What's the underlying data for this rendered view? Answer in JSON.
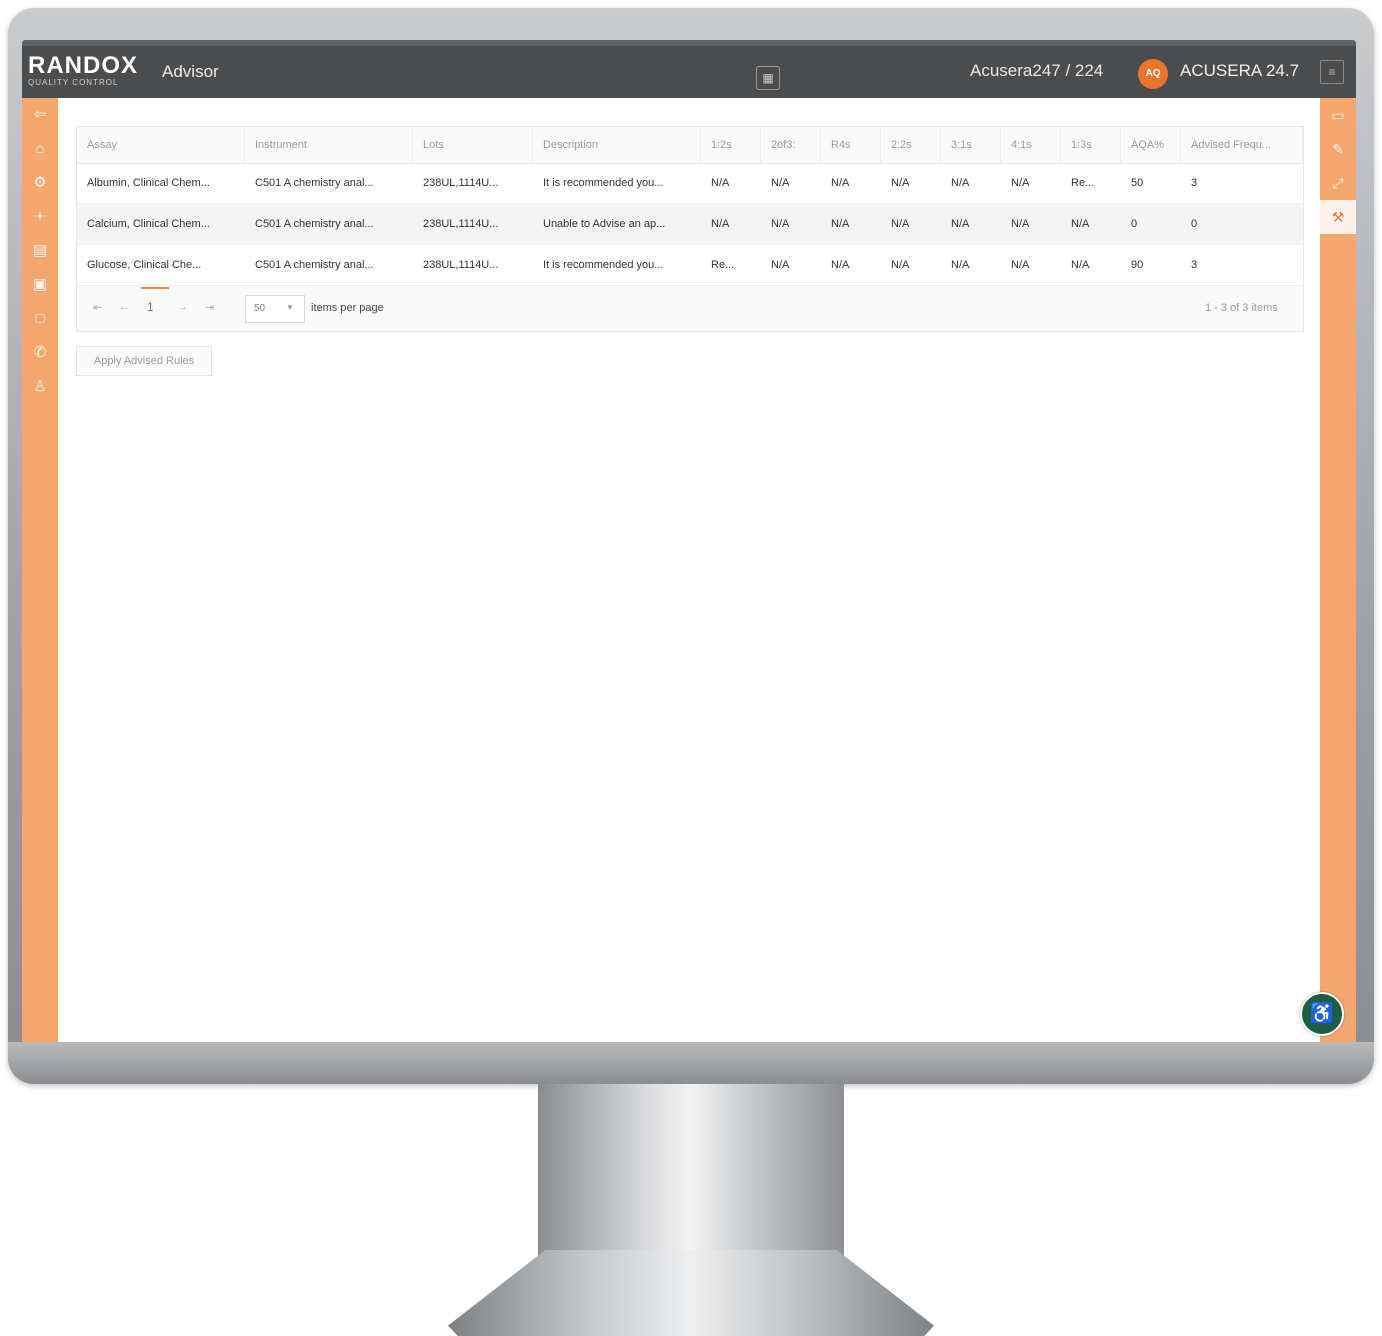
{
  "topbar": {
    "logo_main": "RANDOX",
    "logo_sub": "QUALITY CONTROL",
    "app_title": "Advisor",
    "center_icon": "grid-icon",
    "lab_name": "Acusera247 / 224",
    "user_initials": "AQ",
    "version": "ACUSERA 24.7",
    "menu_icon": "menu-icon"
  },
  "left_nav_icons": [
    "back-icon",
    "home-icon",
    "settings-icon",
    "plus-icon",
    "dashboard-icon",
    "report-icon",
    "document-icon",
    "phone-icon",
    "user-icon"
  ],
  "right_nav_icons": [
    "panel-icon",
    "edit-icon",
    "chart-icon",
    "wrench-icon"
  ],
  "grid": {
    "columns": [
      "Assay",
      "Instrument",
      "Lots",
      "Description",
      "1:2s",
      "2of3:",
      "R4s",
      "2:2s",
      "3:1s",
      "4:1s",
      "1:3s",
      "AQA%",
      "Advised Frequ..."
    ],
    "rows": [
      [
        "Albumin, Clinical Chem...",
        "C501 A chemistry anal...",
        "238UL,1114U...",
        "It is recommended you...",
        "N/A",
        "N/A",
        "N/A",
        "N/A",
        "N/A",
        "N/A",
        "Re...",
        "50",
        "3"
      ],
      [
        "Calcium, Clinical Chem...",
        "C501 A chemistry anal...",
        "238UL,1114U...",
        "Unable to Advise an ap...",
        "N/A",
        "N/A",
        "N/A",
        "N/A",
        "N/A",
        "N/A",
        "N/A",
        "0",
        "0"
      ],
      [
        "Glucose, Clinical Che...",
        "C501 A chemistry anal...",
        "238UL,1114U...",
        "It is recommended you...",
        "Re...",
        "N/A",
        "N/A",
        "N/A",
        "N/A",
        "N/A",
        "N/A",
        "90",
        "3"
      ]
    ]
  },
  "pager": {
    "first": "⇤",
    "prev": "←",
    "current_page": "1",
    "next": "→",
    "last": "⇥",
    "page_size": "50",
    "items_per_page_label": "items per page",
    "item_count": "1 - 3 of 3 items"
  },
  "actions": {
    "apply_label": "Apply Advised Rules"
  },
  "accessibility_icon": "accessibility-icon",
  "colors": {
    "accent_orange": "#f3a76d",
    "topbar": "#4a4c4e",
    "badge_orange": "#e8742f",
    "accessibility_green": "#1f5d45"
  }
}
